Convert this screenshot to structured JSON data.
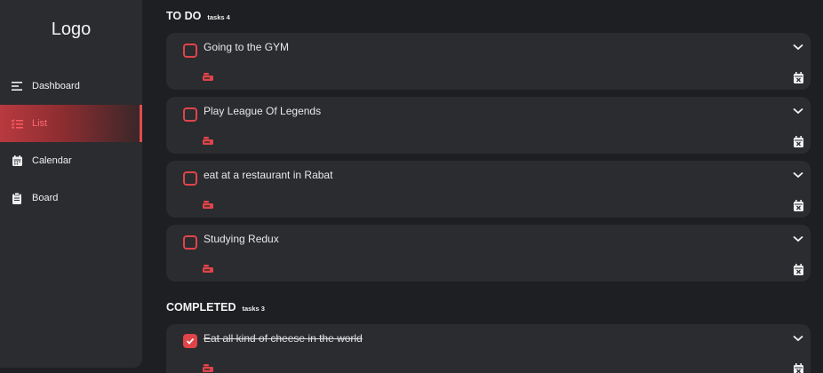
{
  "colors": {
    "background": "#1e1f22",
    "card": "#2a2c30",
    "accent": "#e04449",
    "text": "#e8e8e8"
  },
  "sidebar": {
    "logo": "Logo",
    "items": [
      {
        "label": "Dashboard",
        "icon": "menu-lines-icon",
        "active": false
      },
      {
        "label": "List",
        "icon": "checklist-icon",
        "active": true
      },
      {
        "label": "Calendar",
        "icon": "calendar-icon",
        "active": false
      },
      {
        "label": "Board",
        "icon": "clipboard-icon",
        "active": false
      }
    ]
  },
  "todo": {
    "title": "TO DO",
    "count": "tasks 4",
    "tasks": [
      {
        "title": "Going to the GYM",
        "completed": false
      },
      {
        "title": "Play League Of Legends",
        "completed": false
      },
      {
        "title": "eat at a restaurant in Rabat",
        "completed": false
      },
      {
        "title": "Studying Redux",
        "completed": false
      }
    ]
  },
  "completed": {
    "title": "COMPLETED",
    "count": "tasks 3",
    "tasks": [
      {
        "title": "Eat all kind of cheese in the world",
        "completed": true
      }
    ]
  }
}
